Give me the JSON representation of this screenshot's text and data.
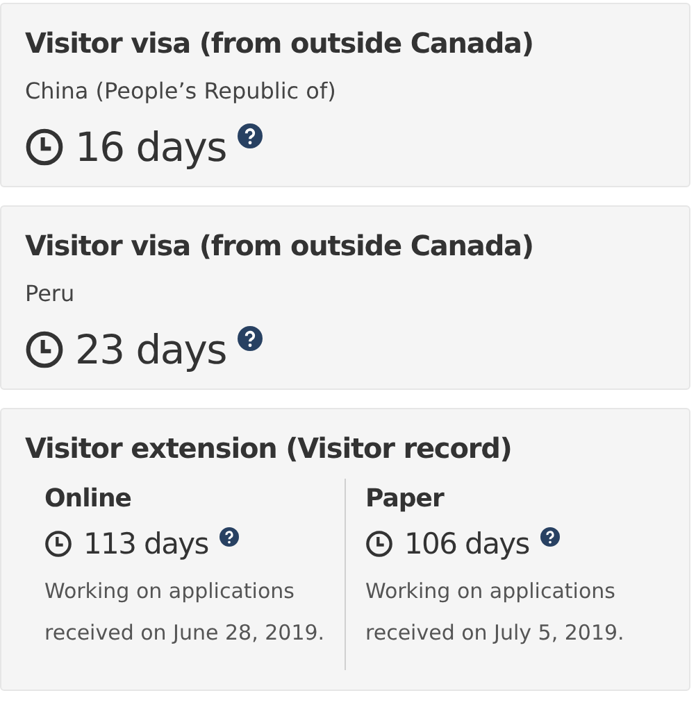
{
  "cards": [
    {
      "kind": "single",
      "title": "Visitor visa (from outside Canada)",
      "country": "China (People’s Republic of)",
      "time": "16 days"
    },
    {
      "kind": "single",
      "title": "Visitor visa (from outside Canada)",
      "country": "Peru",
      "time": "23 days"
    },
    {
      "kind": "split",
      "title": "Visitor extension (Visitor record)",
      "columns": [
        {
          "heading": "Online",
          "time": "113 days",
          "note": "Working on applications received on June 28, 2019."
        },
        {
          "heading": "Paper",
          "time": "106 days",
          "note": "Working on applications received on July 5, 2019."
        }
      ]
    }
  ]
}
